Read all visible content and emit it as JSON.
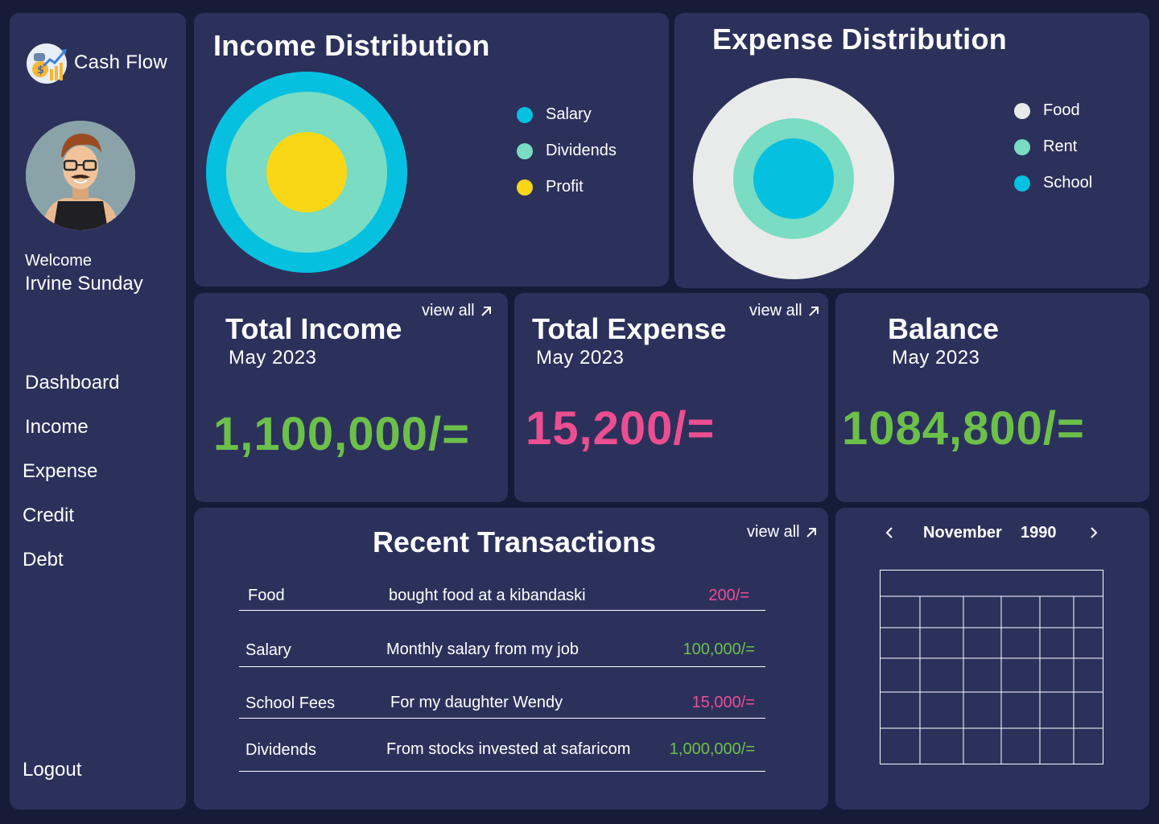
{
  "colors": {
    "background": "#161c38",
    "panel": "#2c315c",
    "green": "#6cc04a",
    "pink": "#ec4e91",
    "cyan": "#06c0e0",
    "mint": "#79dcc3",
    "yellow": "#f9d716",
    "light_gray": "#e9ebea"
  },
  "sidebar": {
    "brand": "Cash Flow",
    "welcome": "Welcome",
    "username": "Irvine Sunday",
    "nav": [
      "Dashboard",
      "Income",
      "Expense",
      "Credit",
      "Debt"
    ],
    "logout": "Logout"
  },
  "income_distribution": {
    "title": "Income Distribution",
    "legend": [
      {
        "label": "Salary",
        "color": "#06c0e0"
      },
      {
        "label": "Dividends",
        "color": "#79dcc3"
      },
      {
        "label": "Profit",
        "color": "#f9d716"
      }
    ]
  },
  "expense_distribution": {
    "title": "Expense Distribution",
    "legend": [
      {
        "label": "Food",
        "color": "#e9ebea"
      },
      {
        "label": "Rent",
        "color": "#79dcc3"
      },
      {
        "label": "School",
        "color": "#06c0e0"
      }
    ]
  },
  "cards": {
    "income": {
      "title": "Total Income",
      "period": "May 2023",
      "value": "1,100,000/=",
      "view_all": "view all"
    },
    "expense": {
      "title": "Total Expense",
      "period": "May 2023",
      "value": "15,200/=",
      "view_all": "view all"
    },
    "balance": {
      "title": "Balance",
      "period": "May 2023",
      "value": "1084,800/="
    }
  },
  "transactions": {
    "title": "Recent Transactions",
    "view_all": "view all",
    "rows": [
      {
        "category": "Food",
        "description": "bought food at a kibandaski",
        "amount": "200/=",
        "type": "expense"
      },
      {
        "category": "Salary",
        "description": "Monthly salary from my job",
        "amount": "100,000/=",
        "type": "income"
      },
      {
        "category": "School Fees",
        "description": "For my daughter Wendy",
        "amount": "15,000/=",
        "type": "expense"
      },
      {
        "category": "Dividends",
        "description": "From stocks invested at safaricom",
        "amount": "1,000,000/=",
        "type": "income"
      }
    ]
  },
  "calendar": {
    "month": "November",
    "year": "1990",
    "prev_icon": "chevron-left-icon",
    "next_icon": "chevron-right-icon"
  }
}
